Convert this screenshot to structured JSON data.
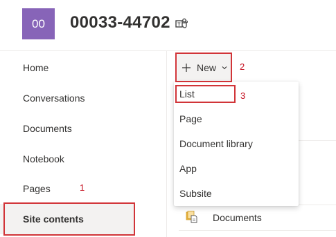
{
  "header": {
    "logo_text": "00",
    "logo_color": "#8764b8",
    "site_title": "00033-44702",
    "teams_icon": "teams-icon"
  },
  "left_nav": {
    "items": [
      {
        "label": "Home"
      },
      {
        "label": "Conversations"
      },
      {
        "label": "Documents"
      },
      {
        "label": "Notebook"
      },
      {
        "label": "Pages"
      },
      {
        "label": "Site contents",
        "selected": true
      }
    ]
  },
  "command_bar": {
    "new_label": "New",
    "new_icon": "plus-icon",
    "chevron_icon": "chevron-down-icon"
  },
  "new_menu": {
    "items": [
      {
        "label": "List"
      },
      {
        "label": "Page"
      },
      {
        "label": "Document library"
      },
      {
        "label": "App"
      },
      {
        "label": "Subsite"
      }
    ]
  },
  "content": {
    "rows": [
      {
        "label": "Documents",
        "icon": "document-library-icon"
      }
    ]
  },
  "annotations": {
    "color": "#d13438",
    "labels": [
      "1",
      "2",
      "3"
    ]
  }
}
